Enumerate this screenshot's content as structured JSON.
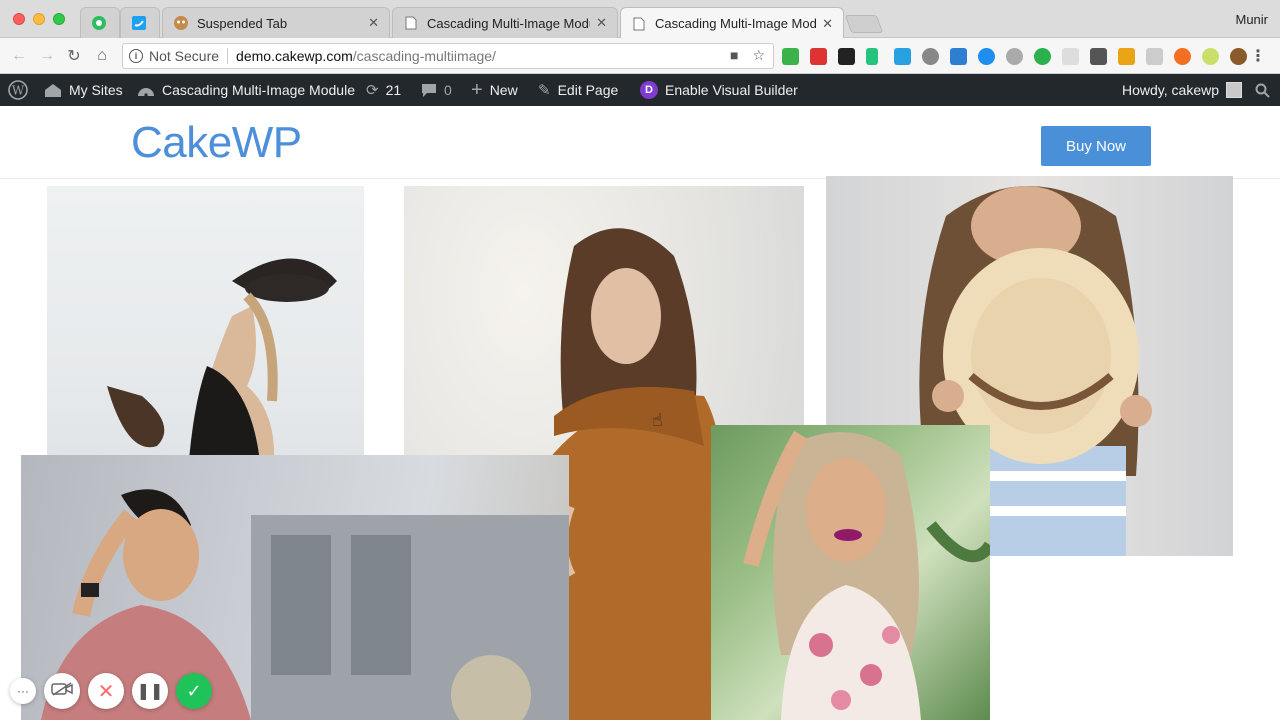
{
  "browser": {
    "tabs": [
      {
        "title": "",
        "icon": "evernote-icon"
      },
      {
        "title": "",
        "icon": "twitter-icon"
      },
      {
        "title": "Suspended Tab",
        "icon": "suspended-icon"
      },
      {
        "title": "Cascading Multi-Image Module",
        "icon": "page-icon"
      },
      {
        "title": "Cascading Multi-Image Module",
        "icon": "page-icon",
        "active": true
      }
    ],
    "profile_name": "Munir",
    "security_label": "Not Secure",
    "url_host": "demo.cakewp.com",
    "url_path": "/cascading-multiimage/"
  },
  "admin_bar": {
    "my_sites": "My Sites",
    "site_name": "Cascading Multi-Image Module",
    "updates_count": "21",
    "comments_count": "0",
    "new_label": "New",
    "edit_page": "Edit Page",
    "visual_builder": "Enable Visual Builder",
    "divi_letter": "D",
    "howdy": "Howdy, cakewp"
  },
  "site": {
    "logo": "CakeWP",
    "buy_button": "Buy Now",
    "accent_color": "#4a90d9"
  },
  "images": [
    {
      "name": "woman-with-black-hat"
    },
    {
      "name": "woman-in-orange-sweater"
    },
    {
      "name": "woman-holding-straw-hat"
    },
    {
      "name": "man-touching-hair"
    },
    {
      "name": "smiling-woman-with-purple-lipstick"
    }
  ],
  "recorder": {
    "more": "···",
    "cancel": "✕",
    "pause": "❚❚",
    "done": "✓"
  }
}
